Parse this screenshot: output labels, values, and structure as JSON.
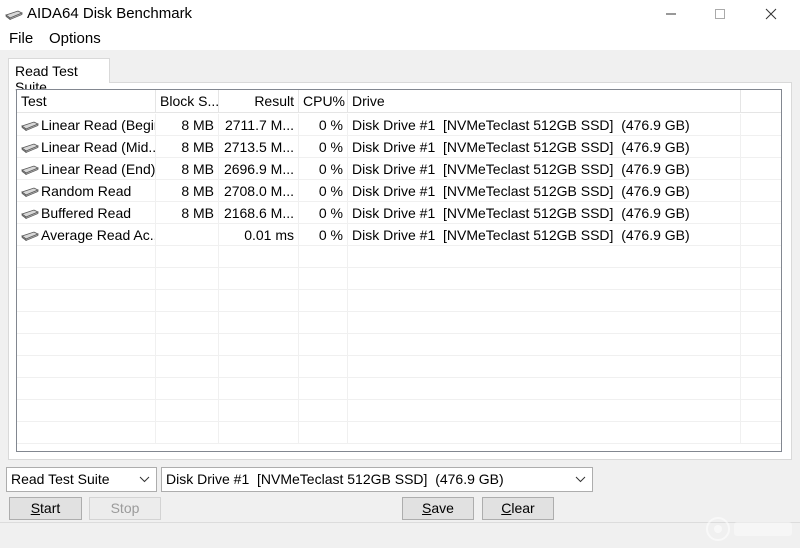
{
  "window": {
    "title": "AIDA64 Disk Benchmark",
    "icon": "disk-drive-icon",
    "controls": [
      "minimize-icon",
      "maximize-icon",
      "close-icon"
    ]
  },
  "menu": {
    "file": "File",
    "options": "Options"
  },
  "tab": {
    "label": "Read Test Suite"
  },
  "table": {
    "headers": {
      "test": "Test",
      "block": "Block S...",
      "result": "Result",
      "cpu": "CPU%",
      "drive": "Drive"
    },
    "rows": [
      {
        "test": "Linear Read (Begin)",
        "block": "8 MB",
        "result": "2711.7 M...",
        "cpu": "0 %",
        "drive": "Disk Drive #1  [NVMeTeclast 512GB SSD]  (476.9 GB)"
      },
      {
        "test": "Linear Read (Mid...",
        "block": "8 MB",
        "result": "2713.5 M...",
        "cpu": "0 %",
        "drive": "Disk Drive #1  [NVMeTeclast 512GB SSD]  (476.9 GB)"
      },
      {
        "test": "Linear Read (End)",
        "block": "8 MB",
        "result": "2696.9 M...",
        "cpu": "0 %",
        "drive": "Disk Drive #1  [NVMeTeclast 512GB SSD]  (476.9 GB)"
      },
      {
        "test": "Random Read",
        "block": "8 MB",
        "result": "2708.0 M...",
        "cpu": "0 %",
        "drive": "Disk Drive #1  [NVMeTeclast 512GB SSD]  (476.9 GB)"
      },
      {
        "test": "Buffered Read",
        "block": "8 MB",
        "result": "2168.6 M...",
        "cpu": "0 %",
        "drive": "Disk Drive #1  [NVMeTeclast 512GB SSD]  (476.9 GB)"
      },
      {
        "test": "Average Read Ac...",
        "block": "",
        "result": "0.01 ms",
        "cpu": "0 %",
        "drive": "Disk Drive #1  [NVMeTeclast 512GB SSD]  (476.9 GB)"
      }
    ]
  },
  "controls": {
    "suite_select": "Read Test Suite",
    "drive_select": "Disk Drive #1  [NVMeTeclast 512GB SSD]  (476.9 GB)",
    "start": "Start",
    "stop": "Stop",
    "save": "Save",
    "clear": "Clear"
  },
  "colors": {
    "window_bg": "#f0f0f0",
    "titlebar_bg": "#ffffff",
    "disabled_text": "#9b9b9b"
  }
}
